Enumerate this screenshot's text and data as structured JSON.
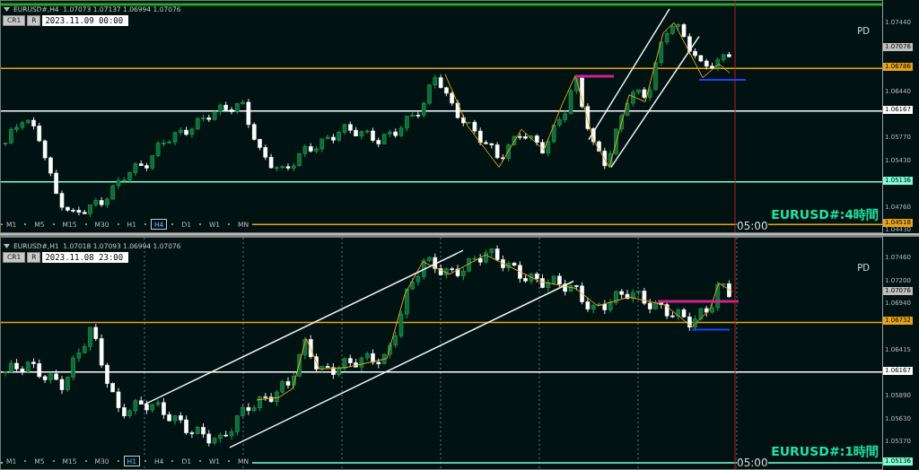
{
  "charts": [
    {
      "header": "EURUSD#,H4  1.07073 1.07137 1.06994 1.07076",
      "buttons": [
        "CR1",
        "R"
      ],
      "date": "2023.11.09 00:00",
      "pd_label": "PD",
      "title": "EURUSD#:4時間",
      "time_label": "05:00",
      "timeframes": [
        {
          "label": "M1",
          "selected": false
        },
        {
          "label": "M5",
          "selected": false
        },
        {
          "label": "M15",
          "selected": false
        },
        {
          "label": "M30",
          "selected": false
        },
        {
          "label": "H1",
          "selected": false
        },
        {
          "label": "H4",
          "selected": true
        },
        {
          "label": "D1",
          "selected": false
        },
        {
          "label": "W1",
          "selected": false
        },
        {
          "label": "MN",
          "selected": false
        }
      ],
      "yticks": [
        "1.07440",
        "1.06440",
        "1.05770",
        "1.05430",
        "1.04760",
        "1.04430"
      ],
      "price_tags": [
        {
          "label": "1.07076",
          "kind": "current",
          "color": "#c0c0c0"
        },
        {
          "label": "1.06786",
          "kind": "level",
          "color": "#e8a317"
        },
        {
          "label": "1.06167",
          "kind": "level",
          "color": "#ffffff"
        },
        {
          "label": "1.05136",
          "kind": "level",
          "color": "#7fffd4"
        },
        {
          "label": "1.04518",
          "kind": "level",
          "color": "#e8a317"
        }
      ]
    },
    {
      "header": "EURUSD#,H1  1.07018 1.07093 1.06994 1.07076",
      "buttons": [
        "CR1",
        "R"
      ],
      "date": "2023.11.08 23:00",
      "pd_label": "PD",
      "title": "EURUSD#:1時間",
      "time_label": "05:00",
      "timeframes": [
        {
          "label": "M1",
          "selected": false
        },
        {
          "label": "M5",
          "selected": false
        },
        {
          "label": "M15",
          "selected": false
        },
        {
          "label": "M30",
          "selected": false
        },
        {
          "label": "H1",
          "selected": true
        },
        {
          "label": "H4",
          "selected": false
        },
        {
          "label": "D1",
          "selected": false
        },
        {
          "label": "W1",
          "selected": false
        },
        {
          "label": "MN",
          "selected": false
        }
      ],
      "yticks": [
        "1.07460",
        "1.07200",
        "1.06940",
        "1.06415",
        "1.05890",
        "1.05630",
        "1.05370"
      ],
      "price_tags": [
        {
          "label": "1.07076",
          "kind": "current",
          "color": "#c0c0c0"
        },
        {
          "label": "1.06732",
          "kind": "level",
          "color": "#e8a317"
        },
        {
          "label": "1.06167",
          "kind": "level",
          "color": "#ffffff"
        },
        {
          "label": "1.05136",
          "kind": "level",
          "color": "#7fffd4"
        }
      ]
    }
  ]
}
